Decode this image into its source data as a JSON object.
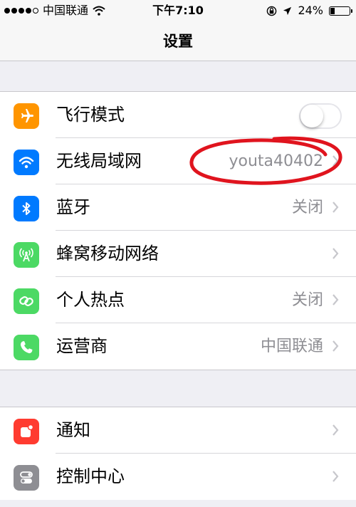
{
  "status_bar": {
    "carrier": "中国联通",
    "time": "下午7:10",
    "battery": "24%",
    "battery_level": 0.24,
    "signal_bars": 4,
    "icons": [
      "signal-dots-icon",
      "wifi-icon",
      "rotation-lock-icon",
      "location-arrow-icon",
      "battery-icon"
    ]
  },
  "nav": {
    "title": "设置"
  },
  "groups": [
    {
      "rows": [
        {
          "label": "飞行模式",
          "icon": "airplane-icon",
          "color": "#ff9500",
          "control": "toggle",
          "on": false
        },
        {
          "label": "无线局域网",
          "icon": "wifi-icon",
          "color": "#007aff",
          "value": "youta40402"
        },
        {
          "label": "蓝牙",
          "icon": "bluetooth-icon",
          "color": "#007aff",
          "value": "关闭"
        },
        {
          "label": "蜂窝移动网络",
          "icon": "cellular-antenna-icon",
          "color": "#4cd964"
        },
        {
          "label": "个人热点",
          "icon": "hotspot-chain-icon",
          "color": "#4cd964",
          "value": "关闭"
        },
        {
          "label": "运营商",
          "icon": "phone-icon",
          "color": "#4cd964",
          "value": "中国联通"
        }
      ]
    },
    {
      "rows": [
        {
          "label": "通知",
          "icon": "notifications-icon",
          "color": "#ff3b30"
        },
        {
          "label": "控制中心",
          "icon": "control-center-icon",
          "color": "#8e8e93"
        }
      ]
    }
  ],
  "annotation_color": "#e0141e"
}
